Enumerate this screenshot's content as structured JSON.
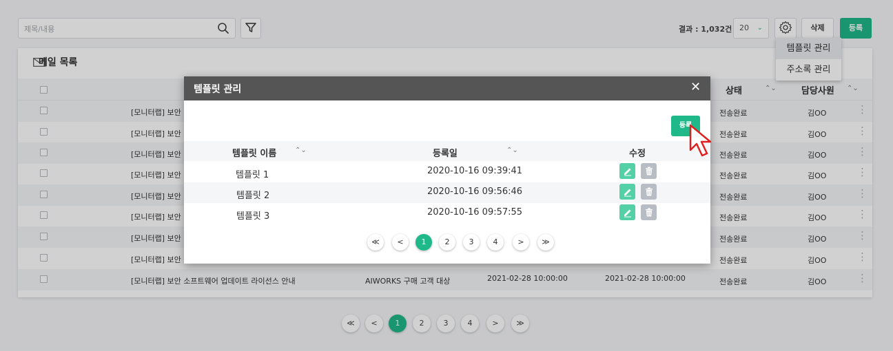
{
  "toolbar": {
    "search_placeholder": "제목/내용",
    "result_text": "결과 : 1,032건",
    "page_size": "20",
    "delete_label": "삭제",
    "register_label": "등록"
  },
  "settings_menu": {
    "items": [
      "템플릿 관리",
      "주소록 관리"
    ]
  },
  "card": {
    "title": "메일 목록",
    "columns": {
      "status": "상태",
      "owner": "담당사원"
    },
    "rows": [
      {
        "subject": "[모니터랩] 보안",
        "status": "전송완료",
        "owner": "김OO"
      },
      {
        "subject": "[모니터랩] 보안",
        "status": "전송완료",
        "owner": "김OO"
      },
      {
        "subject": "[모니터랩] 보안",
        "status": "전송완료",
        "owner": "김OO"
      },
      {
        "subject": "[모니터랩] 보안",
        "status": "전송완료",
        "owner": "김OO"
      },
      {
        "subject": "[모니터랩] 보안",
        "status": "전송완료",
        "owner": "김OO"
      },
      {
        "subject": "[모니터랩] 보안",
        "status": "전송완료",
        "owner": "김OO"
      },
      {
        "subject": "[모니터랩] 보안",
        "status": "전송완료",
        "owner": "김OO"
      },
      {
        "subject": "[모니터랩] 보안",
        "status": "전송완료",
        "owner": "김OO"
      },
      {
        "subject": "[모니터랩] 보안 소프트웨어 업데이트 라이선스 안내",
        "recipient": "AIWORKS 구매 고객 대상",
        "date1": "2021-02-28 10:00:00",
        "date2": "2021-02-28 10:00:00",
        "status": "전송완료",
        "owner": "김OO"
      }
    ]
  },
  "pagination": {
    "first": "≪",
    "prev": "<",
    "pages": [
      "1",
      "2",
      "3",
      "4"
    ],
    "next": ">",
    "last": "≫",
    "current": "1"
  },
  "modal": {
    "title": "템플릿 관리",
    "close": "✕",
    "register_label": "등록",
    "columns": {
      "name": "템플릿 이름",
      "date": "등록일",
      "edit": "수정"
    },
    "rows": [
      {
        "name": "템플릿 1",
        "date": "2020-10-16 09:39:41"
      },
      {
        "name": "템플릿 2",
        "date": "2020-10-16 09:56:46"
      },
      {
        "name": "템플릿 3",
        "date": "2020-10-16 09:57:55"
      }
    ],
    "pagination": {
      "first": "≪",
      "prev": "<",
      "pages": [
        "1",
        "2",
        "3",
        "4"
      ],
      "next": ">",
      "last": "≫",
      "current": "1"
    }
  },
  "colors": {
    "accent": "#1fb889",
    "modal_header": "#555556"
  },
  "icons": [
    "search-icon",
    "filter-icon",
    "gear-icon",
    "mail-icon",
    "close-icon",
    "edit-icon",
    "trash-icon",
    "cursor-icon"
  ]
}
